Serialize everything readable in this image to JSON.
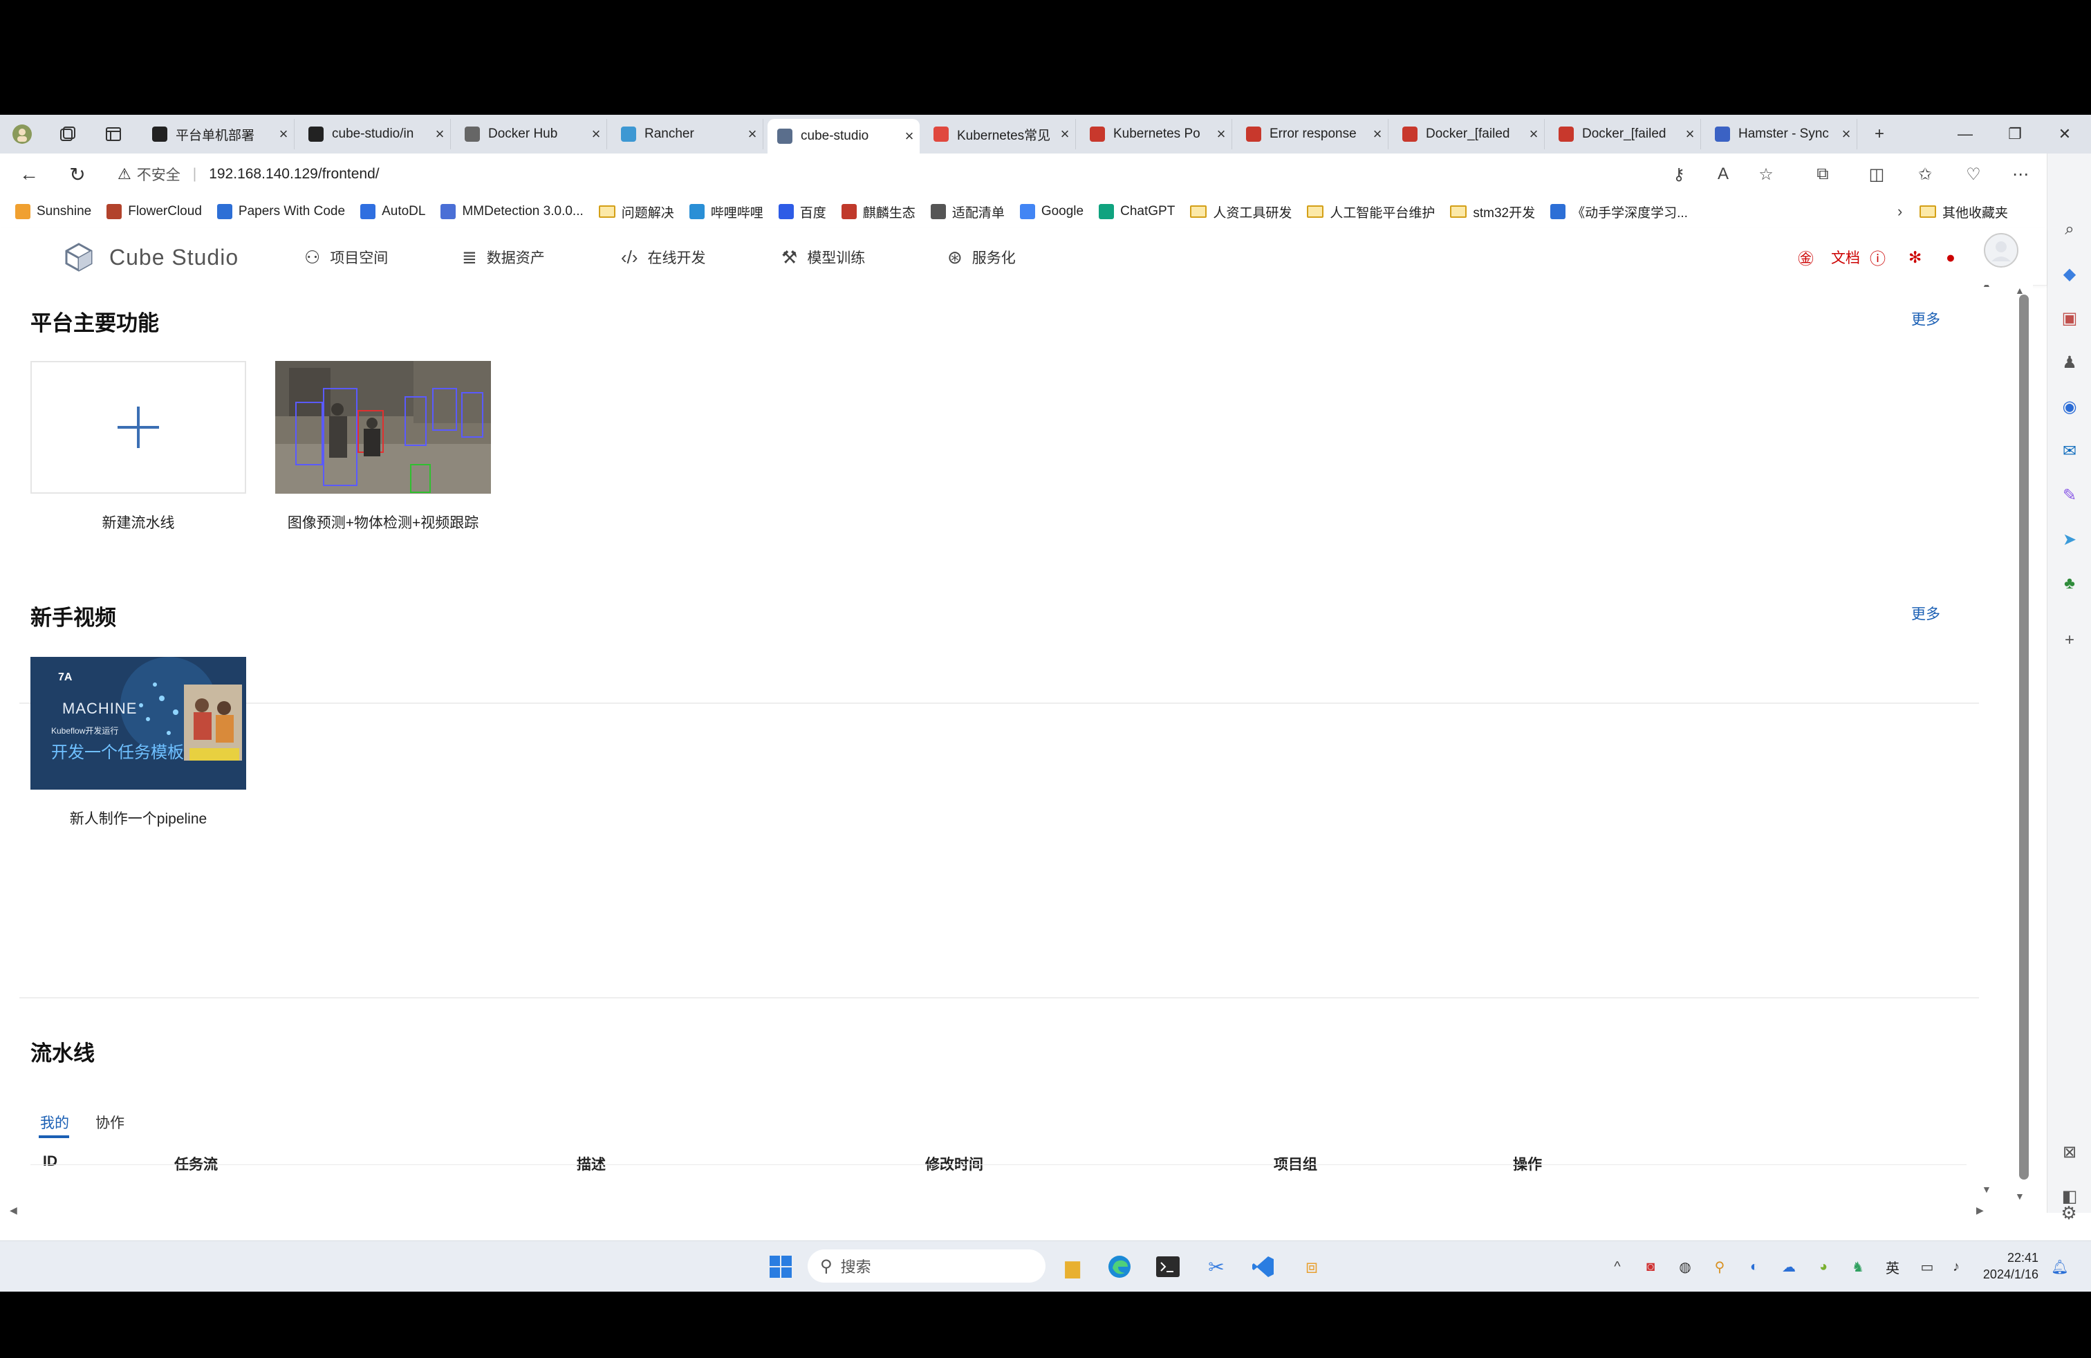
{
  "browser": {
    "tabs": [
      {
        "label": "平台单机部署",
        "fav_color": "#222"
      },
      {
        "label": "cube-studio/in",
        "fav_color": "#222"
      },
      {
        "label": "Docker Hub",
        "fav_color": "#666"
      },
      {
        "label": "Rancher",
        "fav_color": "#3d98d3"
      },
      {
        "label": "cube-studio",
        "fav_color": "#5a6e8c",
        "active": true
      },
      {
        "label": "Kubernetes常见",
        "fav_color": "#e0483e"
      },
      {
        "label": "Kubernetes Po",
        "fav_color": "#c8382c"
      },
      {
        "label": "Error response",
        "fav_color": "#c8382c"
      },
      {
        "label": "Docker_[failed",
        "fav_color": "#c8382c"
      },
      {
        "label": "Docker_[failed",
        "fav_color": "#c8382c"
      },
      {
        "label": "Hamster - Sync",
        "fav_color": "#3b62c4"
      }
    ],
    "address": {
      "security": "不安全",
      "url": "192.168.140.129/frontend/"
    },
    "bookmarks": [
      {
        "label": "Sunshine",
        "icon": "sun-icon",
        "color": "#f0a030"
      },
      {
        "label": "FlowerCloud",
        "icon": "flower-icon",
        "color": "#b2432c"
      },
      {
        "label": "Papers With Code",
        "icon": "papers-icon",
        "color": "#2d6fd6"
      },
      {
        "label": "AutoDL",
        "icon": "autodl-icon",
        "color": "#2f6fe0"
      },
      {
        "label": "MMDetection 3.0.0...",
        "icon": "mm-icon",
        "color": "#4a6fd6"
      },
      {
        "label": "问题解决",
        "icon": "folder-icon"
      },
      {
        "label": "哔哩哔哩",
        "icon": "bilibili-icon",
        "color": "#2a8fd6"
      },
      {
        "label": "百度",
        "icon": "baidu-icon",
        "color": "#2e5ce6"
      },
      {
        "label": "麒麟生态",
        "icon": "kylin-icon",
        "color": "#c0392b"
      },
      {
        "label": "适配清单",
        "icon": "page-icon",
        "color": "#555"
      },
      {
        "label": "Google",
        "icon": "google-icon",
        "color": "#4285f4"
      },
      {
        "label": "ChatGPT",
        "icon": "chatgpt-icon",
        "color": "#10a37f"
      },
      {
        "label": "人资工具研发",
        "icon": "folder-icon"
      },
      {
        "label": "人工智能平台维护",
        "icon": "folder-icon"
      },
      {
        "label": "stm32开发",
        "icon": "folder-icon"
      },
      {
        "label": "《动手学深度学习...",
        "icon": "book-icon",
        "color": "#2d6fd6"
      }
    ],
    "other_bookmarks": "其他收藏夹"
  },
  "app": {
    "brand": "Cube Studio",
    "menu": [
      {
        "label": "项目空间",
        "icon": "users-icon"
      },
      {
        "label": "数据资产",
        "icon": "database-icon"
      },
      {
        "label": "在线开发",
        "icon": "code-icon"
      },
      {
        "label": "模型训练",
        "icon": "train-icon"
      },
      {
        "label": "服务化",
        "icon": "service-icon"
      }
    ],
    "docs_label": "文档"
  },
  "sections": {
    "features": {
      "title": "平台主要功能",
      "more": "更多",
      "cards": [
        {
          "label": "新建流水线"
        },
        {
          "label": "图像预测+物体检测+视频跟踪"
        }
      ]
    },
    "videos": {
      "title": "新手视频",
      "more": "更多",
      "cards": [
        {
          "label": "新人制作一个pipeline",
          "thumb_text_1": "MACHINE",
          "thumb_text_2": "开发一个任务模板",
          "thumb_text_3": "Kubeflow开发运行"
        }
      ]
    },
    "pipelines": {
      "title": "流水线",
      "tabs": [
        "我的",
        "协作"
      ],
      "columns": [
        "ID",
        "任务流",
        "描述",
        "修改时间",
        "项目组",
        "操作"
      ],
      "rows": []
    }
  },
  "taskbar": {
    "search_placeholder": "搜索",
    "ime": "英",
    "time": "22:41",
    "date": "2024/1/16"
  }
}
